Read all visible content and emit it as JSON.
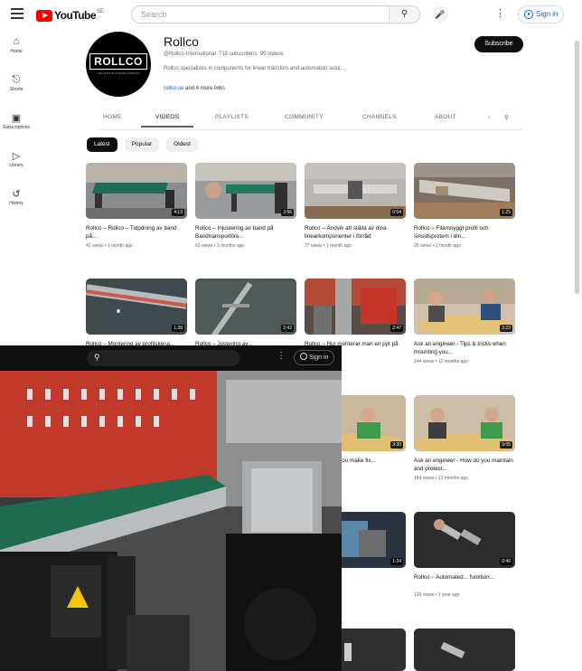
{
  "masthead": {
    "logo": "YouTube",
    "country": "SE",
    "search_placeholder": "Search",
    "signin": "Sign in"
  },
  "sidenav": [
    {
      "icon": "home-icon",
      "label": "Home"
    },
    {
      "icon": "shorts-icon",
      "label": "Shorts"
    },
    {
      "icon": "subscriptions-icon",
      "label": "Subscriptions"
    },
    {
      "icon": "library-icon",
      "label": "Library"
    },
    {
      "icon": "history-icon",
      "label": "History"
    }
  ],
  "channel": {
    "avatar_text": "ROLLCO",
    "avatar_sub": "THE MOTION SYSTEM COMPANY",
    "name": "Rollco",
    "handle": "@Rollco-International",
    "subscribers": "715 subscribers",
    "videos": "95 videos",
    "description": "Rollco specializes in components for linear transfers and automation solut...",
    "link": "rollco.se",
    "more_links": "and 4 more links",
    "subscribe": "Subscribe"
  },
  "tabs": [
    "HOME",
    "VIDEOS",
    "PLAYLISTS",
    "COMMUNITY",
    "CHANNELS",
    "ABOUT"
  ],
  "chips": [
    "Latest",
    "Popular",
    "Oldest"
  ],
  "videos": [
    {
      "title": "Rollco – Rollco – Tidpdning av band på...",
      "meta": "42 views • 1 month ago",
      "duration": "4:13",
      "thumb": "t1"
    },
    {
      "title": "Rollco – Injustering av band på Bandtransportöre...",
      "meta": "63 views • 2 months ago",
      "duration": "3:56",
      "thumb": "t2"
    },
    {
      "title": "Rollco – Ändvik att ställa av dina linearkomponenter i förråd",
      "meta": "27 views • 1 month ago",
      "duration": "0:54",
      "thumb": "t3"
    },
    {
      "title": "Rollco – Filamnyggt profil och sinsidsprotem i din...",
      "meta": "25 views • 1 month ago",
      "duration": "1:25",
      "thumb": "t4"
    },
    {
      "title": "Rollco – Montering av profilskena...",
      "meta": "",
      "duration": "1:38",
      "thumb": "t5"
    },
    {
      "title": "Rollco – Justering av...",
      "meta": "",
      "duration": "2:42",
      "thumb": "t6"
    },
    {
      "title": "Rollco – Hur monterar man en ppt på lådan till?",
      "meta": "",
      "duration": "2:47",
      "thumb": "t7"
    },
    {
      "title": "Ask an engineer - Tips & tricks when mounting you...",
      "meta": "144 views • 12 months ago",
      "duration": "3:23",
      "thumb": "t8"
    }
  ],
  "overlay": {
    "signin": "Sign in"
  },
  "right_column": [
    {
      "title": "Ask an engineer - How do you maintain and protect...",
      "meta": "184 views • 12 months ago",
      "duration": "3:05"
    },
    {
      "title": "Rollco – Automated... funktion...",
      "meta": "130 views • 1 year ago",
      "duration": "0:46"
    }
  ],
  "left_cut": [
    {
      "title": "neer - How do ou make fix...",
      "meta": "13 months ago",
      "duration": "3:30"
    },
    {
      "title": "ify all the way",
      "meta": "ago",
      "duration": "1:34"
    }
  ]
}
